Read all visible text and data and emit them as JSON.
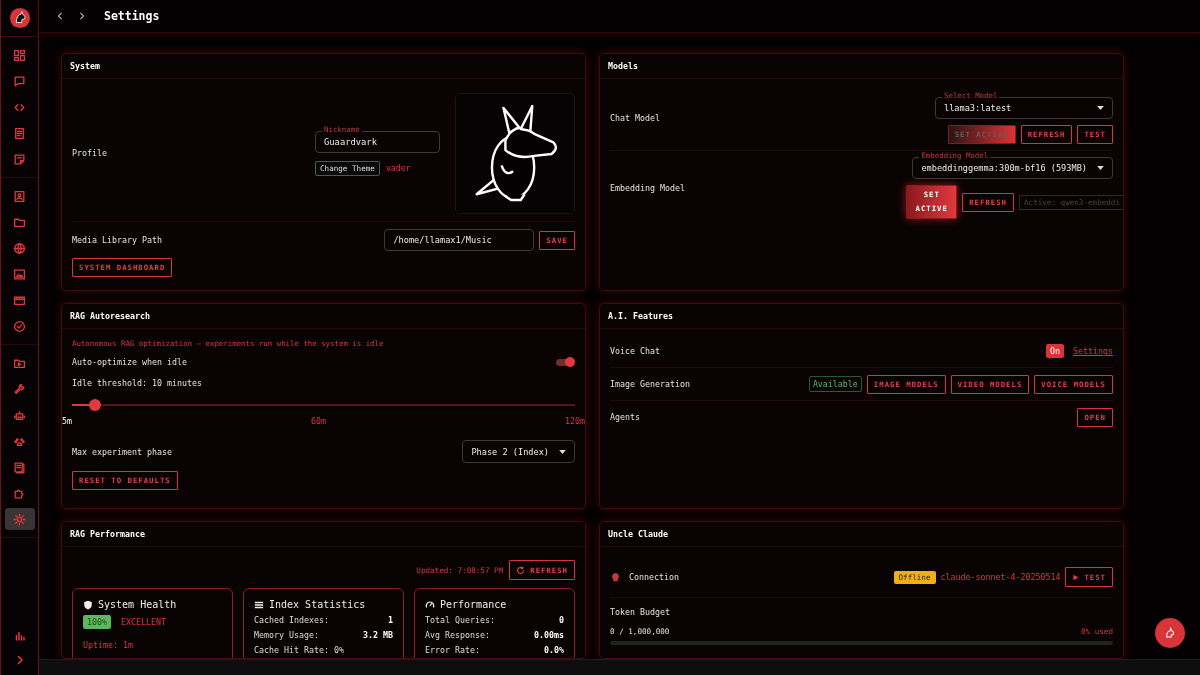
{
  "header": {
    "title": "Settings"
  },
  "sidebar": {
    "groups": [
      [
        {
          "kind": "dashboard",
          "selected": false
        },
        {
          "kind": "chat",
          "selected": false
        },
        {
          "kind": "code",
          "selected": false
        },
        {
          "kind": "document",
          "selected": false
        },
        {
          "kind": "note",
          "selected": false
        }
      ],
      [
        {
          "kind": "contact",
          "selected": false
        },
        {
          "kind": "folder",
          "selected": false
        },
        {
          "kind": "globe",
          "selected": false
        },
        {
          "kind": "image",
          "selected": false
        },
        {
          "kind": "film",
          "selected": false
        },
        {
          "kind": "check",
          "selected": false
        }
      ],
      [
        {
          "kind": "video-folder",
          "selected": false
        },
        {
          "kind": "wrench",
          "selected": false
        },
        {
          "kind": "robot",
          "selected": false
        },
        {
          "kind": "paw",
          "selected": false
        },
        {
          "kind": "book",
          "selected": false
        },
        {
          "kind": "puzzle",
          "selected": false
        },
        {
          "kind": "gear",
          "selected": true
        }
      ]
    ],
    "bottom": [
      {
        "kind": "chart",
        "selected": false
      },
      {
        "kind": "chevron",
        "selected": false
      }
    ]
  },
  "system": {
    "title": "System",
    "profile_label": "Profile",
    "nickname": {
      "label": "Nickname",
      "value": "Guaardvark"
    },
    "theme_button": "Change Theme",
    "theme": "vader",
    "media_label": "Media Library Path",
    "media_path": "/home/llamax1/Music",
    "save": "SAVE",
    "dashboard": "SYSTEM DASHBOARD"
  },
  "models": {
    "title": "Models",
    "rows": [
      {
        "label": "Chat Model",
        "field_label": "Select Model",
        "value": "llama3:latest",
        "buttons": [
          {
            "label": "SET ACTIVE",
            "kind": "primary",
            "disabled": true
          },
          {
            "label": "REFRESH",
            "kind": "outline",
            "disabled": false
          },
          {
            "label": "TEST",
            "kind": "outline",
            "disabled": false
          }
        ]
      },
      {
        "label": "Embedding Model",
        "field_label": "Embedding Model",
        "value": "embeddinggemma:300m-bf16 (593MB)",
        "buttons": [
          {
            "label": "SET ACTIVE",
            "kind": "primary",
            "disabled": false
          },
          {
            "label": "REFRESH",
            "kind": "outline",
            "disabled": false
          }
        ],
        "active": "Active: qwen3-embeddi"
      }
    ]
  },
  "rag_autoresearch": {
    "title": "RAG Autoresearch",
    "description": "Autonomous RAG optimization — experiments run while the system is idle",
    "toggle": {
      "label": "Auto-optimize when idle",
      "on": true
    },
    "threshold": {
      "label": "Idle threshold: 10 minutes",
      "level": 0.045,
      "ticks": [
        {
          "label": "5m",
          "selected": true
        },
        {
          "label": "60m",
          "selected": false
        },
        {
          "label": "120m",
          "selected": false
        }
      ]
    },
    "phase": {
      "label": "Max experiment phase",
      "value": "Phase 2 (Index)"
    },
    "reset": "RESET TO DEFAULTS"
  },
  "ai_features": {
    "title": "A.I. Features",
    "rows": [
      {
        "label": "Voice Chat",
        "status": "On",
        "link": "Settings"
      },
      {
        "label": "Image Generation",
        "badge": "Available",
        "buttons": [
          "IMAGE MODELS",
          "VIDEO MODELS",
          "VOICE MODELS"
        ]
      },
      {
        "label": "Agents",
        "buttons": [
          "OPEN"
        ]
      }
    ]
  },
  "rag_performance": {
    "title": "RAG Performance",
    "updated": "Updated: 7:08:57 PM",
    "refresh": "REFRESH",
    "cards": [
      {
        "kind": "health",
        "title": "System Health",
        "score": "100%",
        "status": "EXCELLENT",
        "uptime": "Uptime: 1m"
      },
      {
        "kind": "index",
        "title": "Index Statistics",
        "stats": [
          {
            "label": "Cached Indexes:",
            "value": "1"
          },
          {
            "label": "Memory Usage:",
            "value": "3.2 MB"
          },
          {
            "label": "Cache Hit Rate: 0%"
          }
        ]
      },
      {
        "kind": "performance",
        "title": "Performance",
        "stats": [
          {
            "label": "Total Queries:",
            "value": "0"
          },
          {
            "label": "Avg Response:",
            "value": "0.00ms"
          },
          {
            "label": "Error Rate:",
            "value": "0.0%"
          }
        ]
      }
    ]
  },
  "uncle_claude": {
    "title": "Uncle Claude",
    "connection": "Connection",
    "status": "Offline",
    "model": "claude-sonnet-4-20250514",
    "test": "TEST",
    "budget_label": "Token Budget",
    "budget_used": "0 / 1,000,000",
    "budget_percent": "0% used",
    "level": 0
  }
}
